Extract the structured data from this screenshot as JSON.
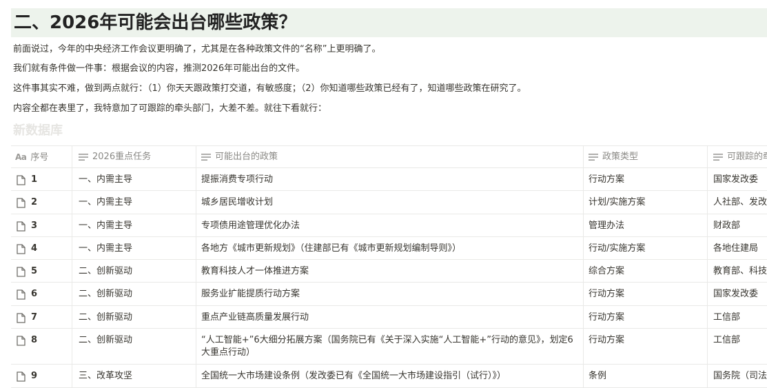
{
  "heading": "二、2026年可能会出台哪些政策？",
  "paragraphs": [
    "前面说过，今年的中央经济工作会议更明确了，尤其是在各种政策文件的“名称”上更明确了。",
    "我们就有条件做一件事：根据会议的内容，推测2026年可能出台的文件。",
    "这件事其实不难，做到两点就行：（1）你天天跟政策打交道，有敏感度；（2）你知道哪些政策已经有了，知道哪些政策在研究了。",
    "内容全都在表里了，我特意加了可跟踪的牵头部门，大差不差。就往下看就行："
  ],
  "database": {
    "title": "新数据库",
    "columns": [
      "序号",
      "2026重点任务",
      "可能出台的政策",
      "政策类型",
      "可跟踪的牵头部门"
    ],
    "rows": [
      {
        "num": "1",
        "task": "一、内需主导",
        "policy": "提振消费专项行动",
        "type": "行动方案",
        "dept": "国家发改委"
      },
      {
        "num": "2",
        "task": "一、内需主导",
        "policy": "城乡居民增收计划",
        "type": "计划/实施方案",
        "dept": "人社部、发改委"
      },
      {
        "num": "3",
        "task": "一、内需主导",
        "policy": "专项债用途管理优化办法",
        "type": "管理办法",
        "dept": "财政部"
      },
      {
        "num": "4",
        "task": "一、内需主导",
        "policy": "各地方《城市更新规划》（住建部已有《城市更新规划编制导则》）",
        "type": "行动/实施方案",
        "dept": "各地住建局"
      },
      {
        "num": "5",
        "task": "二、创新驱动",
        "policy": "教育科技人才一体推进方案",
        "type": "综合方案",
        "dept": "教育部、科技部"
      },
      {
        "num": "6",
        "task": "二、创新驱动",
        "policy": "服务业扩能提质行动方案",
        "type": "行动方案",
        "dept": "国家发改委"
      },
      {
        "num": "7",
        "task": "二、创新驱动",
        "policy": "重点产业链高质量发展行动",
        "type": "行动方案",
        "dept": "工信部"
      },
      {
        "num": "8",
        "task": "二、创新驱动",
        "policy": "“人工智能+”6大细分拓展方案（国务院已有《关于深入实施“人工智能+”行动的意见》，划定6大重点行动）",
        "type": "行动方案",
        "dept": "工信部"
      },
      {
        "num": "9",
        "task": "三、改革攻坚",
        "policy": "全国统一大市场建设条例（发改委已有《全国统一大市场建设指引（试行）》）",
        "type": "条例",
        "dept": "国务院（司法部）"
      }
    ]
  }
}
